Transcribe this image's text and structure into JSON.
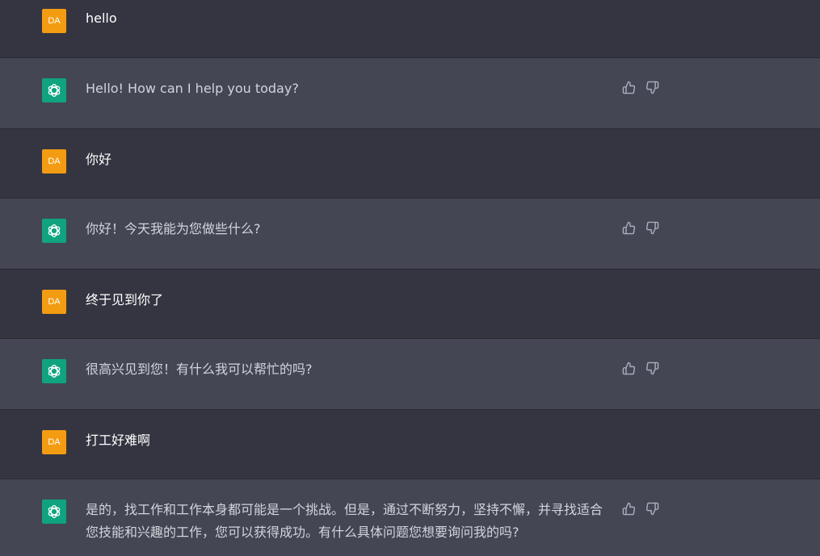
{
  "messages": [
    {
      "role": "user",
      "avatar_label": "DA",
      "text": "hello"
    },
    {
      "role": "assistant",
      "text": "Hello! How can I help you today?"
    },
    {
      "role": "user",
      "avatar_label": "DA",
      "text": "你好"
    },
    {
      "role": "assistant",
      "text": "你好！今天我能为您做些什么?"
    },
    {
      "role": "user",
      "avatar_label": "DA",
      "text": "终于见到你了"
    },
    {
      "role": "assistant",
      "text": "很高兴见到您！有什么我可以帮忙的吗?"
    },
    {
      "role": "user",
      "avatar_label": "DA",
      "text": "打工好难啊"
    },
    {
      "role": "assistant",
      "text": "是的，找工作和工作本身都可能是一个挑战。但是，通过不断努力，坚持不懈，并寻找适合您技能和兴趣的工作，您可以获得成功。有什么具体问题您想要询问我的吗?"
    }
  ],
  "colors": {
    "user_row_bg": "#343541",
    "assistant_row_bg": "#444654",
    "user_avatar_bg": "#f39c12",
    "assistant_avatar_bg": "#10a37f"
  },
  "icons": {
    "assistant_avatar": "openai-logo-icon",
    "like": "thumbs-up-icon",
    "dislike": "thumbs-down-icon"
  }
}
